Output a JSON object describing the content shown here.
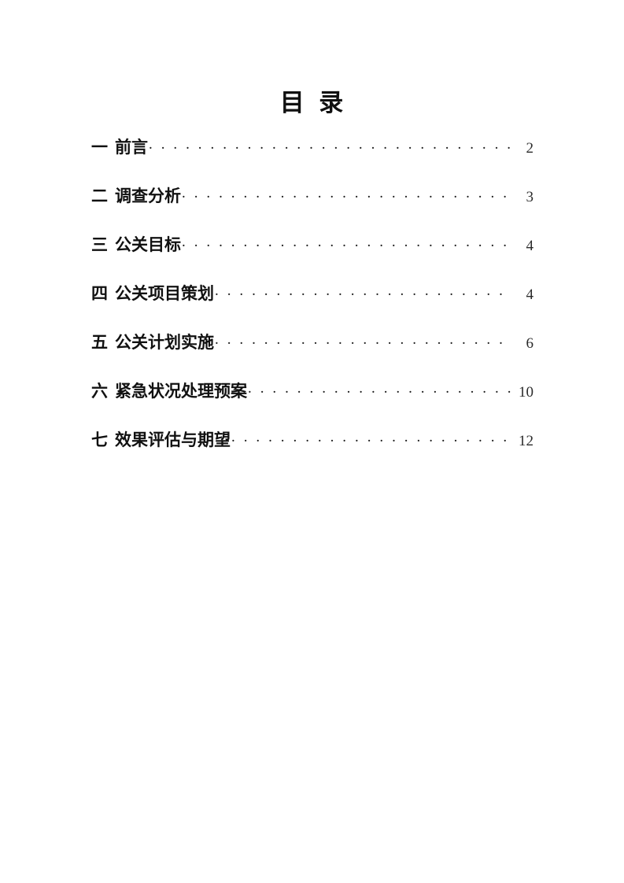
{
  "document": {
    "title": "目  录",
    "page_background": "#ffffff",
    "text_color": "#111111",
    "page_number_color": "#2b2b2b"
  },
  "toc": {
    "entries": [
      {
        "number": "一",
        "title": "前言",
        "page": "2"
      },
      {
        "number": "二",
        "title": "调查分析",
        "page": "3"
      },
      {
        "number": "三",
        "title": "公关目标",
        "page": "4"
      },
      {
        "number": "四",
        "title": "公关项目策划",
        "page": "4"
      },
      {
        "number": "五",
        "title": "公关计划实施",
        "page": "6"
      },
      {
        "number": "六",
        "title": "紧急状况处理预案",
        "page": "10"
      },
      {
        "number": "七",
        "title": "效果评估与期望",
        "page": "12"
      }
    ]
  }
}
